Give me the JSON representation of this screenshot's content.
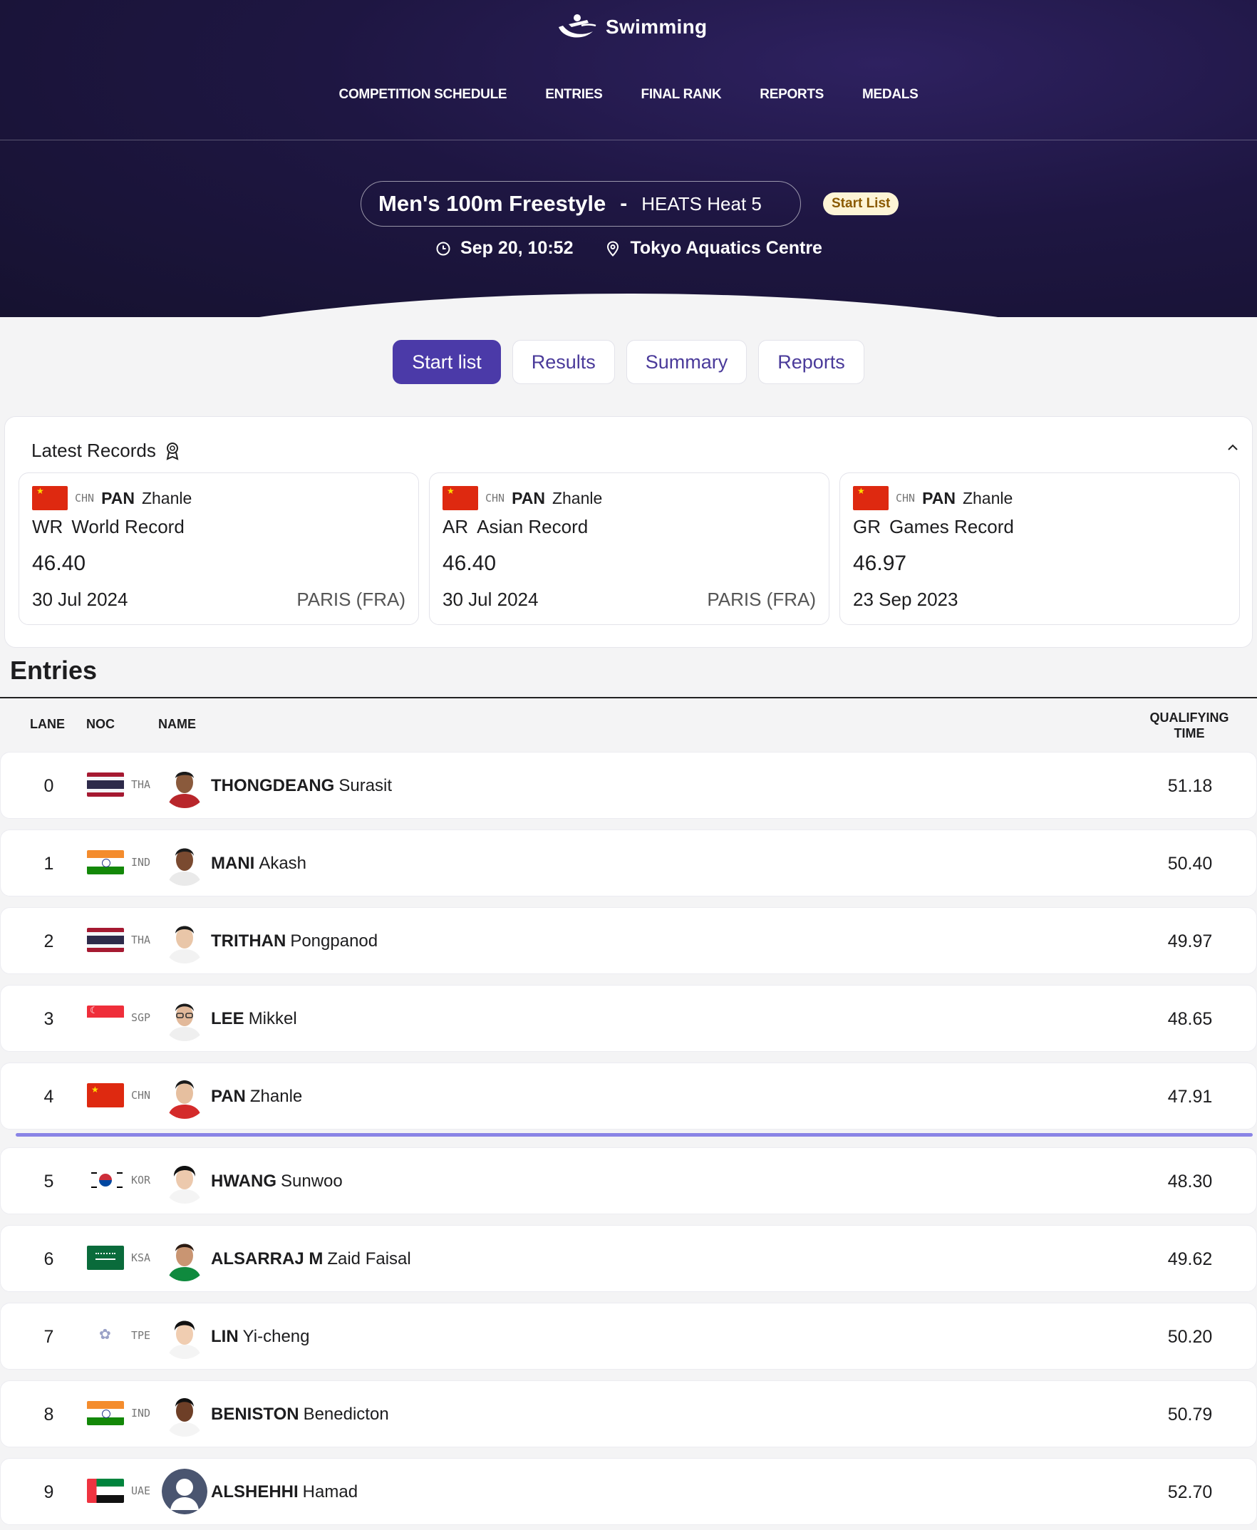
{
  "header": {
    "sport": "Swimming",
    "nav": [
      "COMPETITION SCHEDULE",
      "ENTRIES",
      "FINAL RANK",
      "REPORTS",
      "MEDALS"
    ]
  },
  "event": {
    "name": "Men's 100m Freestyle",
    "separator": "-",
    "heat": "HEATS Heat 5",
    "status_badge": "Start List",
    "datetime": "Sep 20, 10:52",
    "venue": "Tokyo Aquatics Centre"
  },
  "tabs": [
    "Start list",
    "Results",
    "Summary",
    "Reports"
  ],
  "active_tab": "Start list",
  "records": {
    "title": "Latest Records",
    "items": [
      {
        "noc": "CHN",
        "family": "PAN",
        "given": "Zhanle",
        "abbr": "WR",
        "type": "World Record",
        "time": "46.40",
        "date": "30 Jul 2024",
        "place": "PARIS (FRA)"
      },
      {
        "noc": "CHN",
        "family": "PAN",
        "given": "Zhanle",
        "abbr": "AR",
        "type": "Asian Record",
        "time": "46.40",
        "date": "30 Jul 2024",
        "place": "PARIS (FRA)"
      },
      {
        "noc": "CHN",
        "family": "PAN",
        "given": "Zhanle",
        "abbr": "GR",
        "type": "Games Record",
        "time": "46.97",
        "date": "23 Sep 2023",
        "place": ""
      }
    ]
  },
  "entries": {
    "title": "Entries",
    "columns": {
      "lane": "LANE",
      "noc": "NOC",
      "name": "NAME",
      "time_line1": "QUALIFYING",
      "time_line2": "TIME"
    },
    "rows": [
      {
        "lane": "0",
        "noc": "THA",
        "family": "THONGDEANG",
        "given": "Surasit",
        "time": "51.18"
      },
      {
        "lane": "1",
        "noc": "IND",
        "family": "MANI",
        "given": "Akash",
        "time": "50.40"
      },
      {
        "lane": "2",
        "noc": "THA",
        "family": "TRITHAN",
        "given": "Pongpanod",
        "time": "49.97"
      },
      {
        "lane": "3",
        "noc": "SGP",
        "family": "LEE",
        "given": "Mikkel",
        "time": "48.65"
      },
      {
        "lane": "4",
        "noc": "CHN",
        "family": "PAN",
        "given": "Zhanle",
        "time": "47.91"
      },
      {
        "lane": "5",
        "noc": "KOR",
        "family": "HWANG",
        "given": "Sunwoo",
        "time": "48.30"
      },
      {
        "lane": "6",
        "noc": "KSA",
        "family": "ALSARRAJ M",
        "given": "Zaid Faisal",
        "time": "49.62"
      },
      {
        "lane": "7",
        "noc": "TPE",
        "family": "LIN",
        "given": "Yi-cheng",
        "time": "50.20"
      },
      {
        "lane": "8",
        "noc": "IND",
        "family": "BENISTON",
        "given": "Benedicton",
        "time": "50.79"
      },
      {
        "lane": "9",
        "noc": "UAE",
        "family": "ALSHEHHI",
        "given": "Hamad",
        "time": "52.70"
      }
    ]
  },
  "colors": {
    "accent": "#4b3aa8",
    "header_bg": "#1e1642",
    "qualify_line": "#8a84e6",
    "badge_bg": "#fdf4d6"
  }
}
